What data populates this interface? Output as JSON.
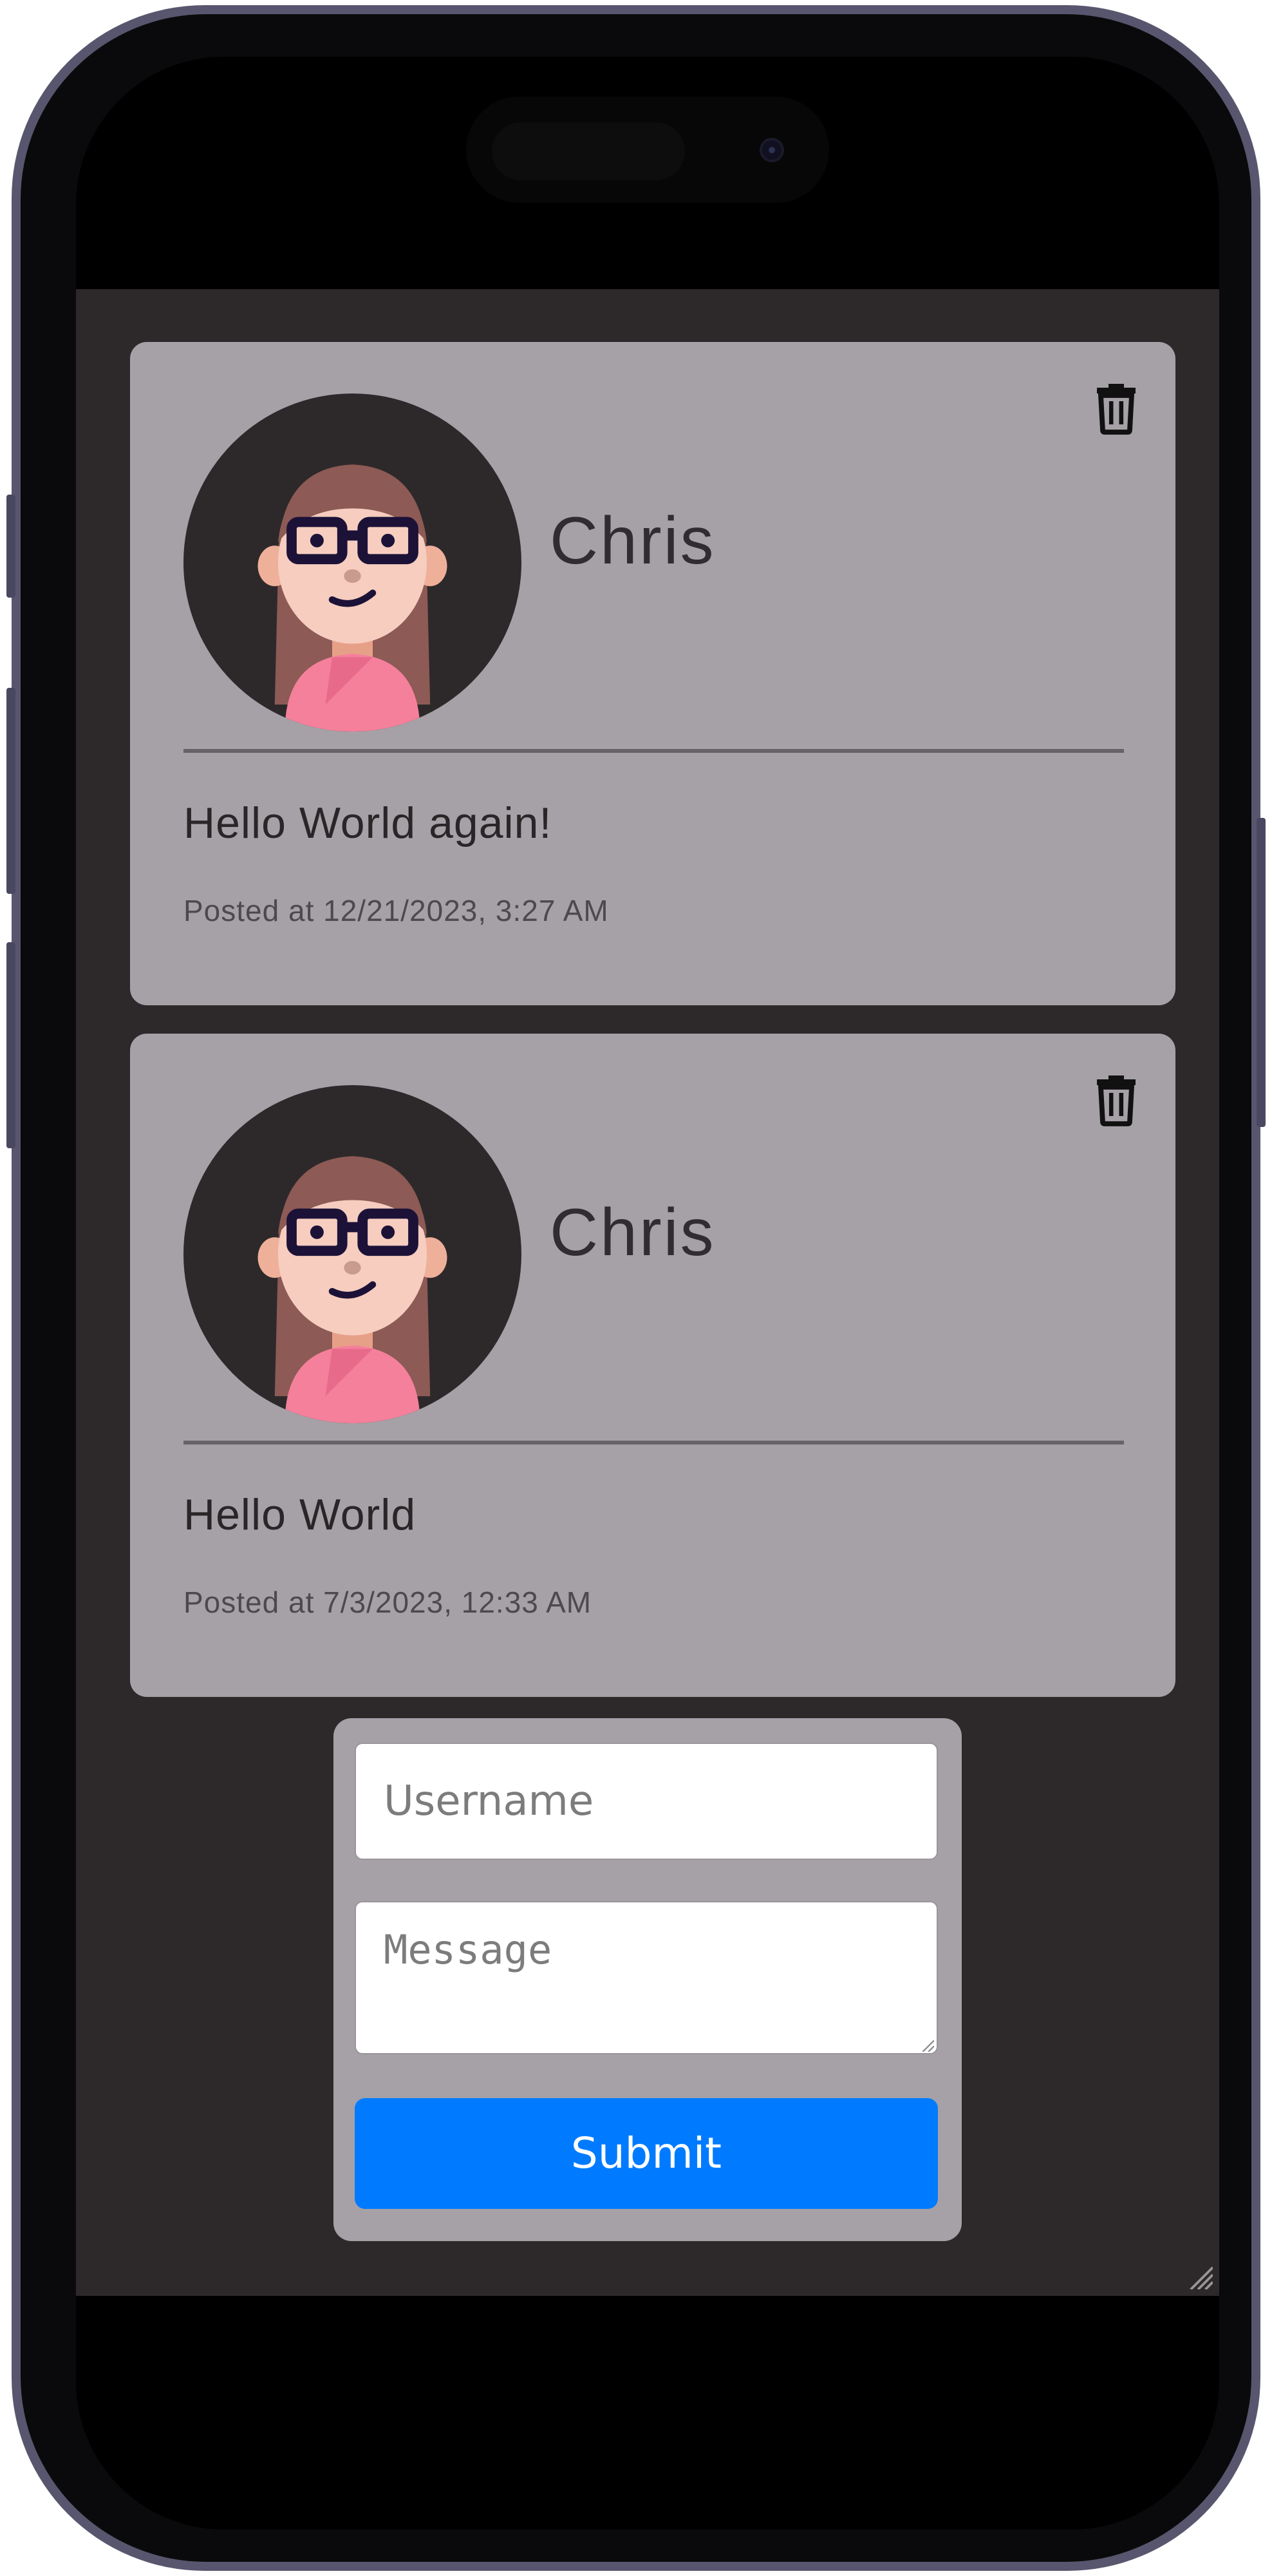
{
  "posts": [
    {
      "author": "Chris",
      "message": "Hello World again!",
      "timestamp": "Posted at 12/21/2023, 3:27 AM",
      "avatar_icon": "avatar-woman-glasses",
      "delete_icon": "trash-icon"
    },
    {
      "author": "Chris",
      "message": "Hello World",
      "timestamp": "Posted at 7/3/2023, 12:33 AM",
      "avatar_icon": "avatar-woman-glasses",
      "delete_icon": "trash-icon"
    }
  ],
  "form": {
    "username": {
      "value": "",
      "placeholder": "Username"
    },
    "message": {
      "value": "",
      "placeholder": "Message"
    },
    "submit_label": "Submit"
  },
  "colors": {
    "background": "#2d292a",
    "card": "#a6a1a7",
    "submit": "#007bff",
    "phone_frame": "#58566e"
  }
}
